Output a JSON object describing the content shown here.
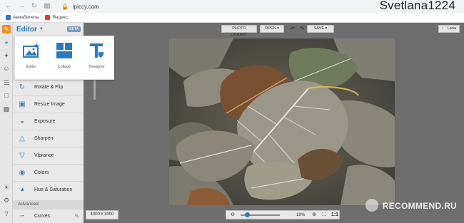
{
  "browser": {
    "url": "ipiccy.com",
    "watermark_user": "Svetlana1224",
    "bookmarks": [
      {
        "label": "Авиабилеты",
        "color": "#3b73c4"
      },
      {
        "label": "Яндекс",
        "color": "#e33b2e"
      }
    ]
  },
  "app": {
    "editor_title": "Editor",
    "beta_badge": "BETA",
    "popup": {
      "items": [
        {
          "label": "Editor",
          "icon": "photo-sparkle-icon"
        },
        {
          "label": "Collage",
          "icon": "collage-grid-icon"
        },
        {
          "label": "Designer",
          "icon": "text-heart-icon"
        }
      ]
    },
    "tools": [
      {
        "label": "Rotate & Flip",
        "icon": "rotate-icon"
      },
      {
        "label": "Resize Image",
        "icon": "resize-icon"
      },
      {
        "label": "Exposure",
        "icon": "exposure-icon"
      },
      {
        "label": "Sharpen",
        "icon": "sharpen-icon"
      },
      {
        "label": "Vibrance",
        "icon": "vibrance-icon"
      },
      {
        "label": "Colors",
        "icon": "colors-icon"
      },
      {
        "label": "Hue & Saturation",
        "icon": "hue-icon"
      }
    ],
    "advanced_label": "Advanced",
    "advanced_tools": [
      {
        "label": "Curves",
        "icon": "curves-icon"
      }
    ],
    "toolbar": {
      "photo_library": "PHOTO LIBRARY",
      "open": "OPEN",
      "save": "SAVE",
      "lang": "Lana"
    },
    "bottom": {
      "dimensions": "4000 x 3000",
      "zoom": "18%",
      "zoom_fraction": 0.18,
      "fit_label": "1:1"
    },
    "watermark": "RECOMMEND.RU",
    "accent": "#2a7bbf"
  }
}
